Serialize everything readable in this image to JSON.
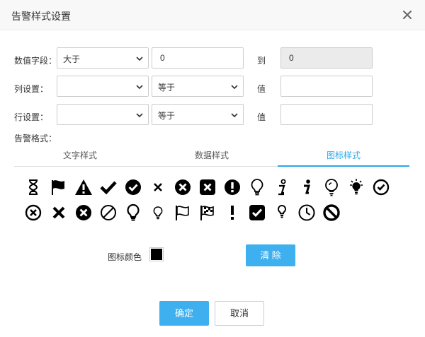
{
  "dialog": {
    "title": "告警样式设置",
    "close_icon": "close-icon"
  },
  "form": {
    "field_label": "数值字段：",
    "field_operator": "大于",
    "field_value": "0",
    "to_label": "到",
    "to_value": "0",
    "column_label": "列设置：",
    "column_select": "",
    "column_operator": "等于",
    "column_value_label": "值",
    "column_value": "",
    "row_label": "行设置：",
    "row_select": "",
    "row_operator": "等于",
    "row_value_label": "值",
    "row_value": "",
    "alert_format_label": "告警格式："
  },
  "tabs": [
    {
      "label": "文字样式",
      "active": false
    },
    {
      "label": "数据样式",
      "active": false
    },
    {
      "label": "图标样式",
      "active": true
    }
  ],
  "icons": [
    "hourglass-icon",
    "flag-icon",
    "warning-triangle-icon",
    "check-icon",
    "check-circle-icon",
    "x-icon",
    "x-circle-icon",
    "x-square-icon",
    "exclamation-circle-icon",
    "lightbulb-outline-icon",
    "info-outline-icon",
    "info-icon",
    "lightbulb-circle-outline-icon",
    "lightbulb-glow-icon",
    "check-circle-outline-icon",
    "x-circle-outline-icon",
    "x-bold-icon",
    "x-circle-solid-icon",
    "ban-outline-icon",
    "lightbulb-outline-2-icon",
    "lightbulb-small-icon",
    "flag-outline-icon",
    "checkered-flag-icon",
    "exclamation-icon",
    "check-square-icon",
    "lightbulb-tiny-icon",
    "clock-icon",
    "ban-icon"
  ],
  "icon_color": {
    "label": "图标颜色",
    "value": "#000000"
  },
  "buttons": {
    "clear": "清 除",
    "confirm": "确定",
    "cancel": "取消"
  },
  "colors": {
    "accent": "#3fb0ef",
    "tab_active": "#2aa7e8"
  }
}
